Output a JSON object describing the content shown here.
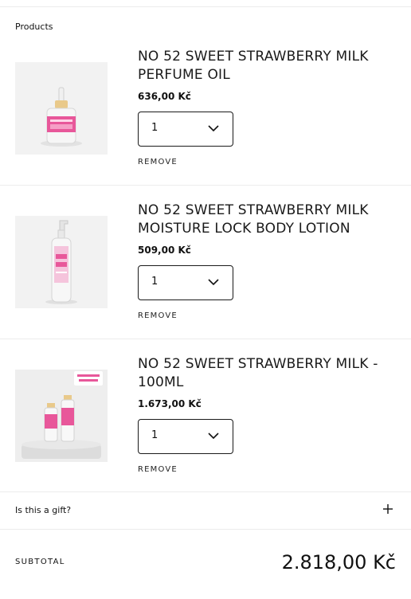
{
  "section_title": "Products",
  "items": [
    {
      "title_line1": "NO 52 SWEET STRAWBERRY MILK",
      "title_line2": "PERFUME OIL",
      "price": "636,00 Kč",
      "quantity": "1",
      "remove_label": "REMOVE",
      "image_icon": "perfume-oil-bottle"
    },
    {
      "title_line1": "NO 52 SWEET STRAWBERRY MILK",
      "title_line2": "MOISTURE LOCK BODY LOTION",
      "price": "509,00 Kč",
      "quantity": "1",
      "remove_label": "REMOVE",
      "image_icon": "body-lotion-pump-bottle"
    },
    {
      "title_line1": "NO 52 SWEET STRAWBERRY MILK -",
      "title_line2": "100ML",
      "price": "1.673,00 Kč",
      "quantity": "1",
      "remove_label": "REMOVE",
      "image_icon": "perfume-bottles-on-podium"
    }
  ],
  "gift": {
    "label": "Is this a gift?",
    "icon": "plus-icon"
  },
  "subtotal": {
    "label": "SUBTOTAL",
    "value": "2.818,00 Kč"
  },
  "colors": {
    "text": "#111111",
    "divider": "#ececec",
    "accent_pink": "#e8579a"
  }
}
